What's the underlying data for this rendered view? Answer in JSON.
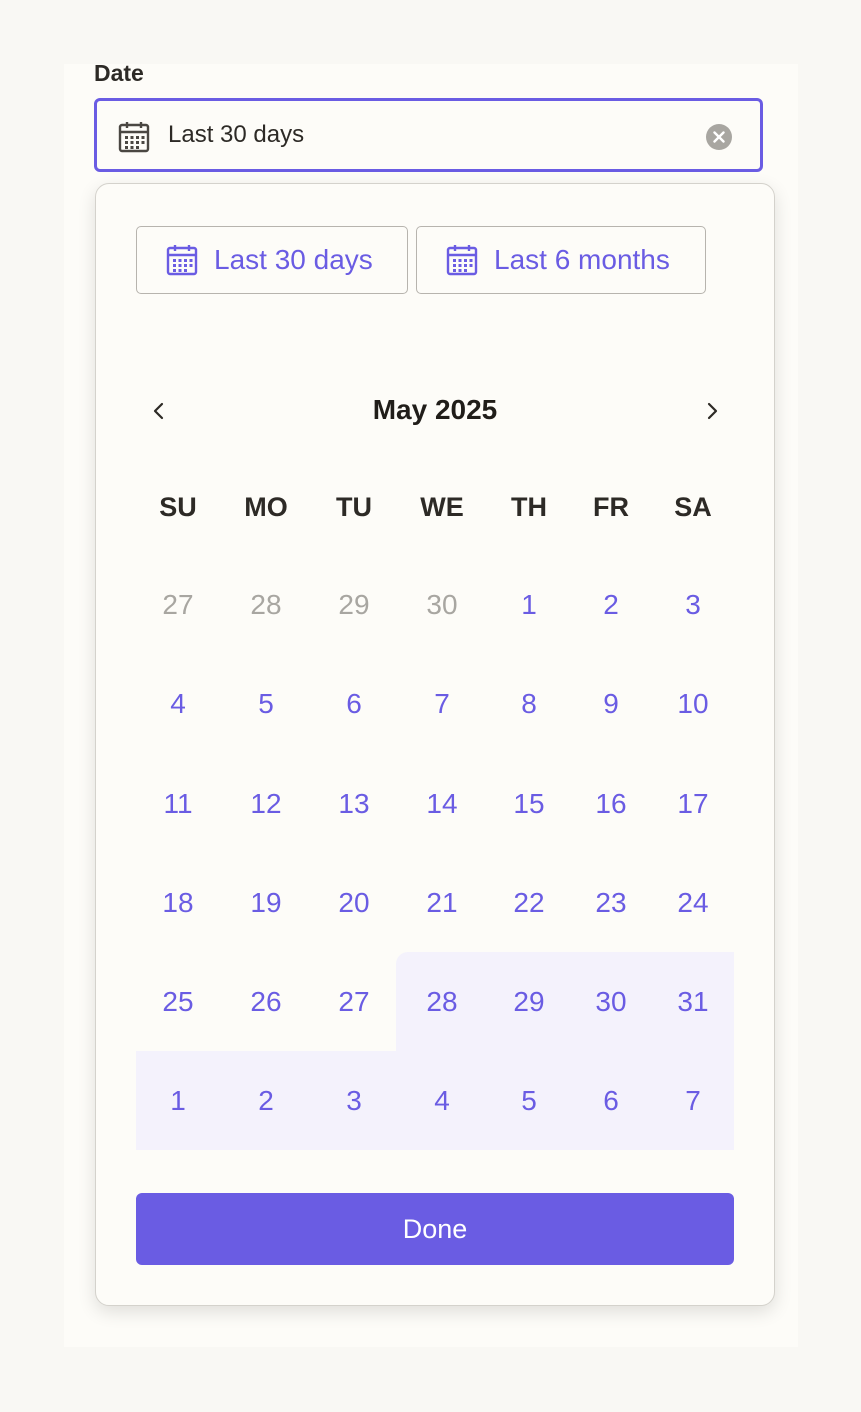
{
  "field": {
    "label": "Date",
    "value": "Last 30 days"
  },
  "presets": [
    {
      "label": "Last 30 days"
    },
    {
      "label": "Last 6 months"
    }
  ],
  "calendar": {
    "month_title": "May 2025",
    "weekdays": [
      "SU",
      "MO",
      "TU",
      "WE",
      "TH",
      "FR",
      "SA"
    ],
    "weeks": [
      [
        {
          "d": "27",
          "m": true
        },
        {
          "d": "28",
          "m": true
        },
        {
          "d": "29",
          "m": true
        },
        {
          "d": "30",
          "m": true
        },
        {
          "d": "1"
        },
        {
          "d": "2"
        },
        {
          "d": "3"
        }
      ],
      [
        {
          "d": "4"
        },
        {
          "d": "5"
        },
        {
          "d": "6"
        },
        {
          "d": "7"
        },
        {
          "d": "8"
        },
        {
          "d": "9"
        },
        {
          "d": "10"
        }
      ],
      [
        {
          "d": "11"
        },
        {
          "d": "12"
        },
        {
          "d": "13"
        },
        {
          "d": "14"
        },
        {
          "d": "15"
        },
        {
          "d": "16"
        },
        {
          "d": "17"
        }
      ],
      [
        {
          "d": "18"
        },
        {
          "d": "19"
        },
        {
          "d": "20"
        },
        {
          "d": "21"
        },
        {
          "d": "22"
        },
        {
          "d": "23"
        },
        {
          "d": "24"
        }
      ],
      [
        {
          "d": "25"
        },
        {
          "d": "26"
        },
        {
          "d": "27"
        },
        {
          "d": "28"
        },
        {
          "d": "29"
        },
        {
          "d": "30"
        },
        {
          "d": "31"
        }
      ],
      [
        {
          "d": "1"
        },
        {
          "d": "2"
        },
        {
          "d": "3"
        },
        {
          "d": "4"
        },
        {
          "d": "5"
        },
        {
          "d": "6"
        },
        {
          "d": "7"
        }
      ]
    ]
  },
  "done_label": "Done",
  "colors": {
    "accent": "#6a5ce3",
    "range_highlight": "#f4f2fc",
    "muted_text": "#a8a6a1"
  },
  "icons": {
    "field_icon": "calendar-icon",
    "clear_icon": "close-circle-icon",
    "preset_icon": "calendar-icon",
    "prev_icon": "chevron-left-icon",
    "next_icon": "chevron-right-icon"
  }
}
